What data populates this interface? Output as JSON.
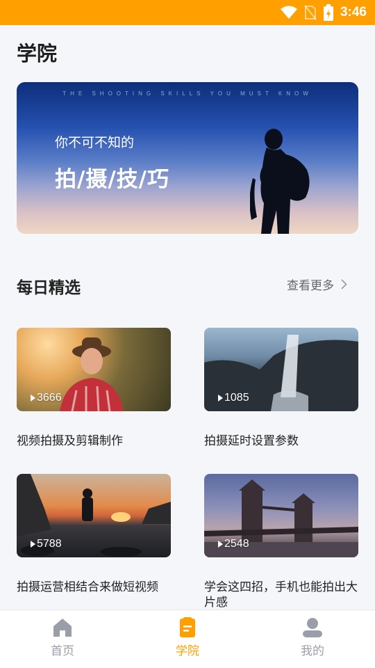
{
  "status_bar": {
    "time": "3:46",
    "color": "#ffa000"
  },
  "page": {
    "title": "学院"
  },
  "banner": {
    "eng_text": "THE SHOOTING SKILLS YOU MUST KNOW",
    "subtitle": "你不可不知的",
    "title": "拍/摄/技/巧"
  },
  "section": {
    "title": "每日精选",
    "more_label": "查看更多"
  },
  "videos": [
    {
      "plays": "3666",
      "title": "视频拍摄及剪辑制作"
    },
    {
      "plays": "1085",
      "title": "拍摄延时设置参数"
    },
    {
      "plays": "5788",
      "title": "拍摄运营相结合来做短视频"
    },
    {
      "plays": "2548",
      "title": "学会这四招，手机也能拍出大片感"
    }
  ],
  "tabs": [
    {
      "label": "首页",
      "icon": "home-icon",
      "active": false
    },
    {
      "label": "学院",
      "icon": "clipboard-icon",
      "active": true
    },
    {
      "label": "我的",
      "icon": "profile-icon",
      "active": false
    }
  ],
  "colors": {
    "accent": "#ffa000",
    "inactive": "#9a9ea8"
  }
}
